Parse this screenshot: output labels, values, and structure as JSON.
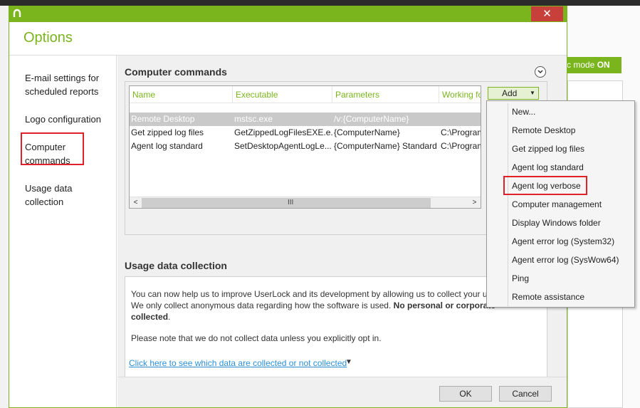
{
  "background": {
    "mode_label": "tic mode",
    "mode_value": "ON"
  },
  "dialog": {
    "title": "Options",
    "close_glyph": "✕"
  },
  "sidebar": {
    "items": [
      {
        "label_line1": "E-mail settings for",
        "label_line2": "scheduled reports"
      },
      {
        "label_line1": "Logo configuration",
        "label_line2": ""
      },
      {
        "label_line1": "Computer",
        "label_line2": "commands"
      },
      {
        "label_line1": "Usage data",
        "label_line2": "collection"
      }
    ]
  },
  "computer_commands": {
    "title": "Computer commands",
    "columns": [
      "Name",
      "Executable",
      "Parameters",
      "Working fo"
    ],
    "rows": [
      {
        "name": "Remote Desktop",
        "executable": "mstsc.exe",
        "parameters": "/v:{ComputerName}",
        "working": ""
      },
      {
        "name": "Get zipped log files",
        "executable": "GetZippedLogFilesEXE.e...",
        "parameters": "{ComputerName}",
        "working": "C:\\Program"
      },
      {
        "name": "Agent log standard",
        "executable": "SetDesktopAgentLogLe...",
        "parameters": "{ComputerName} Standard",
        "working": "C:\\Program"
      }
    ],
    "scroll_left": "<",
    "scroll_right": ">",
    "scroll_grip": "III",
    "add_button": "Add"
  },
  "add_menu": {
    "items": [
      "New...",
      "Remote Desktop",
      "Get zipped log files",
      "Agent log standard",
      "Agent log verbose",
      "Computer management",
      "Display Windows folder",
      "Agent error log (System32)",
      "Agent error log (SysWow64)",
      "Ping",
      "Remote assistance"
    ]
  },
  "usage": {
    "title": "Usage data collection",
    "line1": "You can now help us to improve UserLock and its development by allowing us to collect your u",
    "line2_normal": "We only collect anonymous data regarding how the software is used. ",
    "line2_bold": "No personal or corporate",
    "line3_bold": "collected",
    "line3_normal": ".",
    "line4": "Please note that we do not collect data unless you explicitly opt in.",
    "link": "Click here to see which data are collected or not collected"
  },
  "footer": {
    "ok": "OK",
    "cancel": "Cancel"
  },
  "colors": {
    "accent": "#7ab51d",
    "highlight": "#e2202a",
    "link": "#2a8fd8"
  }
}
